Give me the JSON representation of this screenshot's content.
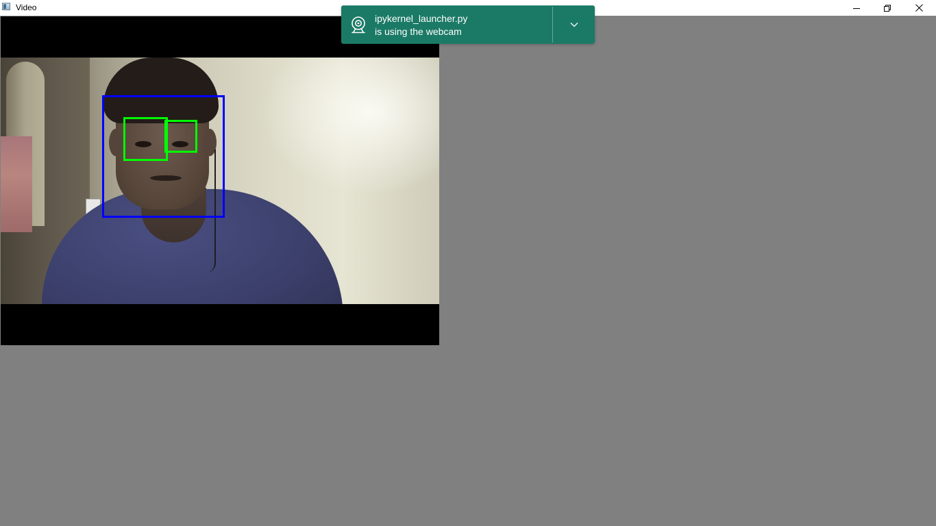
{
  "window": {
    "title": "Video",
    "icon": "window-icon",
    "controls": {
      "minimize_icon": "minimize-icon",
      "maximize_icon": "restore-icon",
      "close_icon": "close-icon"
    }
  },
  "video": {
    "face_box_color": "#0000ff",
    "eye_box_color": "#00ff00"
  },
  "notification": {
    "app_name": "ipykernel_launcher.py",
    "message": "is using the webcam",
    "icon": "webcam-icon",
    "expand_icon": "chevron-down-icon",
    "background_color": "#1b7a66"
  },
  "colors": {
    "desktop_background": "#808080",
    "titlebar_background": "#ffffff"
  }
}
